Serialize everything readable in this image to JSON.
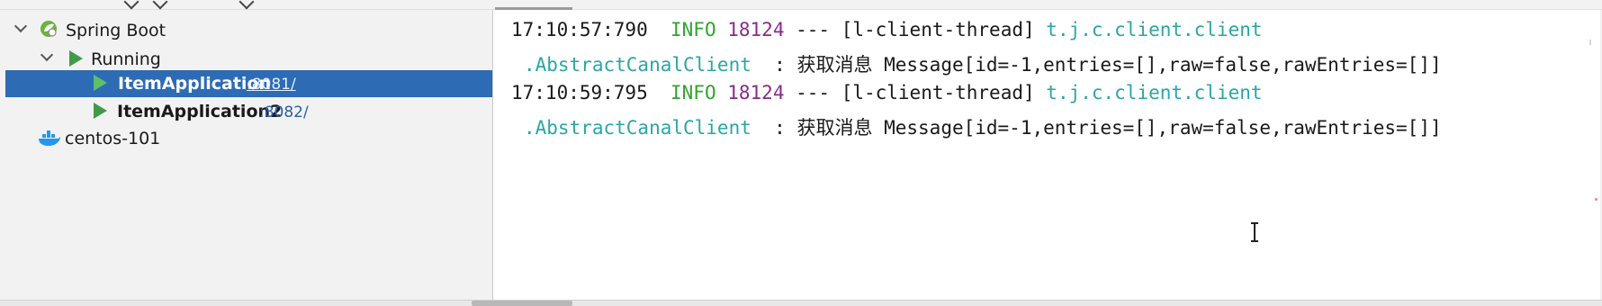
{
  "services": {
    "group": {
      "label": "Spring Boot",
      "icon": "spring-boot-icon"
    },
    "running": {
      "label": "Running",
      "icon": "run-icon"
    },
    "apps": [
      {
        "name": "ItemApplication",
        "port": ":8081/",
        "selected": true
      },
      {
        "name": "ItemApplication2",
        "port": ":8082/",
        "selected": false
      }
    ],
    "docker": {
      "label": "centos-101",
      "icon": "docker-icon"
    }
  },
  "console": {
    "lines": [
      {
        "timestamp": "17:10:57:790",
        "level": "INFO",
        "pid": "18124",
        "thread": "--- [l-client-thread]",
        "logger": "t.j.c.client.client"
      },
      {
        "logger": ".AbstractCanalClient",
        "message": " : 获取消息 Message[id=-1,entries=[],raw=false,rawEntries=[]]"
      },
      {
        "timestamp": "17:10:59:795",
        "level": "INFO",
        "pid": "18124",
        "thread": "--- [l-client-thread]",
        "logger": "t.j.c.client.client"
      },
      {
        "logger": ".AbstractCanalClient",
        "message": " : 获取消息 Message[id=-1,entries=[],raw=false,rawEntries=[]]"
      }
    ]
  },
  "colors": {
    "selection": "#2d6bb5",
    "run_green": "#3f9b4a",
    "info_green": "#2ea52e",
    "pid_purple": "#8a2a8a",
    "logger_teal": "#2aa6a6"
  }
}
